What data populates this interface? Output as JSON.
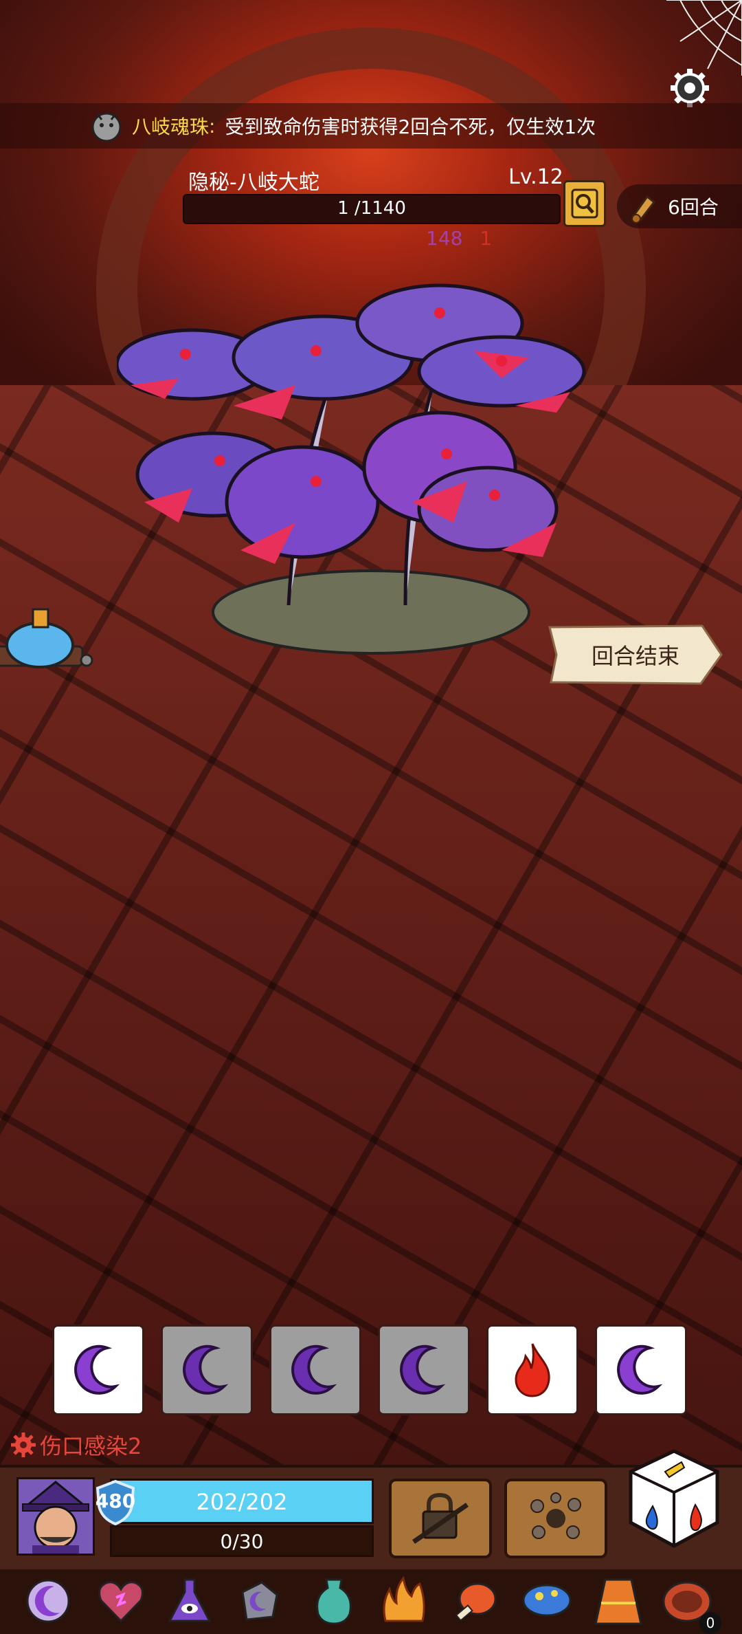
{
  "hint": {
    "name": "八岐魂珠",
    "separator": ":",
    "text": "受到致命伤害时获得2回合不死，仅生效1次"
  },
  "boss": {
    "name": "隐秘-八岐大蛇",
    "level": "Lv.12",
    "hp_text": "1 /1140",
    "hp_fraction": 0.0009,
    "stat_purple": "148",
    "stat_red": "1"
  },
  "turns": {
    "label": "6回合"
  },
  "end_turn": {
    "label": "回合结束"
  },
  "dice_slots": [
    {
      "face": "moon-icon",
      "state": "white"
    },
    {
      "face": "moon-icon",
      "state": "grey"
    },
    {
      "face": "moon-icon",
      "state": "grey"
    },
    {
      "face": "moon-icon",
      "state": "grey"
    },
    {
      "face": "fire-icon",
      "state": "white"
    },
    {
      "face": "moon-icon",
      "state": "white"
    }
  ],
  "debuff": {
    "label": "伤口感染2"
  },
  "player": {
    "shield": "480",
    "hp_text": "202/202",
    "xp_text": "0/30"
  },
  "items": [
    "moon-icon",
    "heart-icon",
    "eye-flask-icon",
    "stone-moon-icon",
    "vase-icon",
    "flame-icon",
    "meat-icon",
    "mushroom-icon",
    "cloak-icon",
    "plate-icon"
  ],
  "items_count": "0",
  "colors": {
    "moon_purple": "#8a3fd0",
    "fire_red": "#e82a1a",
    "hp_cyan": "#5ad0f4",
    "hint_yellow": "#ffd84a",
    "debuff_red": "#e8463a"
  }
}
